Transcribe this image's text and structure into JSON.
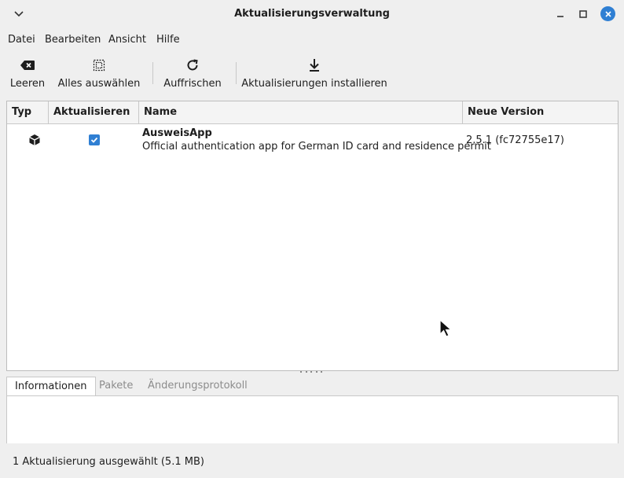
{
  "window": {
    "title": "Aktualisierungsverwaltung",
    "controls": {
      "minimize_icon": "minimize-icon",
      "maximize_icon": "maximize-icon",
      "close_icon": "close-icon"
    }
  },
  "menubar": {
    "items": [
      {
        "label": "Datei"
      },
      {
        "label": "Bearbeiten"
      },
      {
        "label": "Ansicht"
      },
      {
        "label": "Hilfe"
      }
    ]
  },
  "toolbar": {
    "clear": {
      "label": "Leeren",
      "icon": "backspace-icon"
    },
    "select_all": {
      "label": "Alles auswählen",
      "icon": "select-all-icon"
    },
    "refresh": {
      "label": "Auffrischen",
      "icon": "refresh-icon"
    },
    "install": {
      "label": "Aktualisierungen installieren",
      "icon": "download-icon"
    }
  },
  "table": {
    "columns": [
      "Typ",
      "Aktualisieren",
      "Name",
      "Neue Version"
    ],
    "rows": [
      {
        "type_icon": "package-icon",
        "checked": true,
        "name": "AusweisApp",
        "description": "Official authentication app for German ID card and residence permit",
        "version": "2.5.1 (fc72755e17)"
      }
    ]
  },
  "tabs": [
    {
      "label": "Informationen",
      "active": true
    },
    {
      "label": "Pakete",
      "active": false
    },
    {
      "label": "Änderungsprotokoll",
      "active": false
    }
  ],
  "status": {
    "text": "1 Aktualisierung ausgewählt (5.1 MB)"
  },
  "colors": {
    "accent": "#2f7fd3",
    "background": "#efefef"
  }
}
